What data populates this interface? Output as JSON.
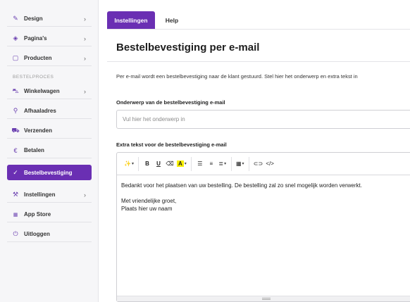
{
  "sidebar": {
    "items_top": [
      {
        "label": "Design",
        "icon": "edit-icon",
        "glyph": "✎"
      },
      {
        "label": "Pagina's",
        "icon": "layers-icon",
        "glyph": "◈"
      },
      {
        "label": "Producten",
        "icon": "box-icon",
        "glyph": "▢"
      }
    ],
    "section_label": "BESTELPROCES",
    "items_order": [
      {
        "label": "Winkelwagen",
        "icon": "cart-icon",
        "glyph": "🛒"
      },
      {
        "label": "Afhaaladres",
        "icon": "pin-icon",
        "glyph": "⚲"
      },
      {
        "label": "Verzenden",
        "icon": "truck-icon",
        "glyph": "⛟"
      },
      {
        "label": "Betalen",
        "icon": "euro-icon",
        "glyph": "€"
      },
      {
        "label": "Bestelbevestiging",
        "icon": "user-check-icon",
        "glyph": "✓"
      }
    ],
    "items_bottom": [
      {
        "label": "Instellingen",
        "icon": "wrench-icon",
        "glyph": "🔧"
      },
      {
        "label": "App Store",
        "icon": "grid-icon",
        "glyph": "⋮⋮"
      },
      {
        "label": "Uitloggen",
        "icon": "power-icon",
        "glyph": "⏻"
      }
    ]
  },
  "tabs": {
    "settings": "Instellingen",
    "help": "Help"
  },
  "page": {
    "title": "Bestelbevestiging per e-mail",
    "description": "Per e-mail wordt een bestelbevestiging naar de klant gestuurd. Stel hier het onderwerp en extra tekst in"
  },
  "subject": {
    "label": "Onderwerp van de bestelbevestiging e-mail",
    "placeholder": "Vul hier het onderwerp in",
    "value": ""
  },
  "editor": {
    "label": "Extra tekst voor de bestelbevestiging e-mail",
    "toolbar": {
      "bold": "B",
      "underline": "U",
      "color": "A"
    },
    "lines": [
      "Bedankt voor het plaatsen van uw bestelling. De bestelling zal zo snel mogelijk worden verwerkt.",
      "Met vriendelijke groet,",
      "Plaats hier uw naam"
    ]
  },
  "colors": {
    "accent": "#6a2fb3",
    "highlight": "#f8f000"
  }
}
